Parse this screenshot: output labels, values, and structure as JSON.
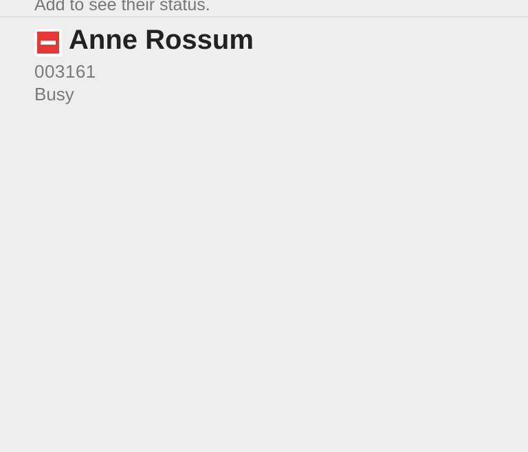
{
  "header": {
    "hint": "Add to see their status."
  },
  "contact": {
    "name": "Anne Rossum",
    "number": "003161",
    "status": "Busy",
    "status_icon": "busy-icon",
    "status_color": "#e53935"
  }
}
